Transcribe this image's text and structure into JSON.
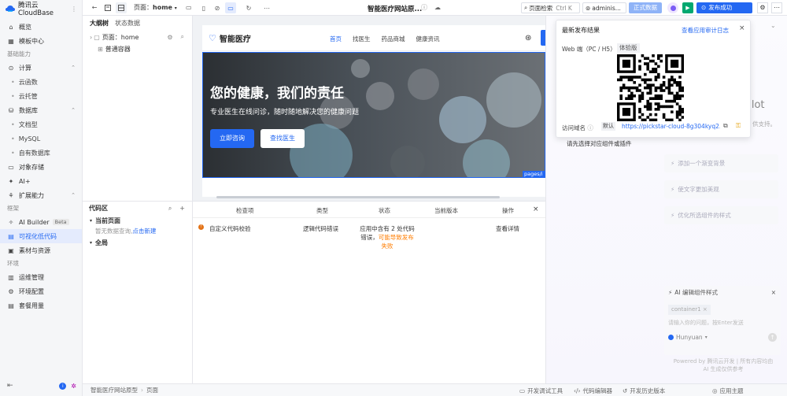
{
  "app": {
    "logo_text": "腾讯云CloudBase",
    "more": "⋮"
  },
  "sidebar": {
    "items": [
      {
        "type": "item",
        "icon": "home-icon",
        "label": "概览"
      },
      {
        "type": "item",
        "icon": "template-icon",
        "label": "模板中心"
      },
      {
        "type": "group",
        "label": "基础能力"
      },
      {
        "type": "item",
        "icon": "compute-icon",
        "label": "计算",
        "caret": true
      },
      {
        "type": "sub",
        "label": "云函数"
      },
      {
        "type": "sub",
        "label": "云托管"
      },
      {
        "type": "item",
        "icon": "database-icon",
        "label": "数据库",
        "caret": true
      },
      {
        "type": "sub",
        "label": "文档型"
      },
      {
        "type": "sub",
        "label": "MySQL"
      },
      {
        "type": "sub",
        "label": "自有数据库"
      },
      {
        "type": "item",
        "icon": "storage-icon",
        "label": "对象存储"
      },
      {
        "type": "item",
        "icon": "ai-icon",
        "label": "AI+"
      },
      {
        "type": "item",
        "icon": "extension-icon",
        "label": "扩展能力",
        "caret": true
      },
      {
        "type": "group",
        "label": "框架"
      },
      {
        "type": "item",
        "icon": "ai-builder-icon",
        "label": "AI Builder",
        "badge": "Beta"
      },
      {
        "type": "item",
        "icon": "visual-dev-icon",
        "label": "可视化低代码",
        "active": true
      },
      {
        "type": "item",
        "icon": "assets-icon",
        "label": "素材与资源"
      },
      {
        "type": "group",
        "label": "环境"
      },
      {
        "type": "item",
        "icon": "ops-icon",
        "label": "运维管理"
      },
      {
        "type": "item",
        "icon": "env-config-icon",
        "label": "环境配置"
      },
      {
        "type": "item",
        "icon": "billing-icon",
        "label": "套餐用量"
      }
    ]
  },
  "topbar": {
    "page_label": "页面：",
    "page_value": "home",
    "title": "智能医疗网站原...",
    "search_label": "页面检索",
    "search_shortcut": "Ctrl K",
    "user": "adminis...",
    "env_button": "正式数据",
    "publish_button": "发布成功"
  },
  "tree": {
    "tabs": [
      "大纲树",
      "状态数据"
    ],
    "page_node_label": "页面：home",
    "container_node": "普通容器"
  },
  "code": {
    "title": "代码区",
    "current_page": "当前页面",
    "empty_text": "暂无数据查询,",
    "create_link": "点击新建",
    "global": "全局"
  },
  "preview": {
    "logo": "智能医疗",
    "nav": [
      "首页",
      "找医生",
      "药品商城",
      "健康资讯"
    ],
    "hero_title": "您的健康，我们的责任",
    "hero_subtitle": "专业医生在线问诊，随时随地解决您的健康问题",
    "primary_button": "立即咨询",
    "secondary_button": "查找医生",
    "path_tag": "pages/i"
  },
  "checks": {
    "headers": [
      "检查项",
      "类型",
      "状态",
      "当前版本",
      "操作"
    ],
    "row": {
      "item": "自定义代码校验",
      "type": "逻辑代码错误",
      "status_1": "应用中含有 2 处代码",
      "status_2": "错误，",
      "status_warn_1": "可能导致发布",
      "status_warn_2": "失败",
      "action": "查看详情"
    },
    "close": "×"
  },
  "popup": {
    "title": "最新发布结果",
    "audit_link": "查看应用审计日志",
    "web_label": "Web 端（PC / H5）",
    "tag": "体验版",
    "domain_label": "访问域名",
    "default_tag": "默认",
    "url": "https://pickstar-cloud-8g304kyq2...",
    "hint": "请先选择对应组件或插件",
    "close": "×"
  },
  "copilot": {
    "title_fragment": "pilot",
    "desc_fragment": "供支持。",
    "suggestions": [
      "添加一个渐变背景",
      "使文字更加美观",
      "优化所选组件的样式"
    ],
    "edit_title": "AI 编辑组件样式",
    "chip": "container1",
    "input_placeholder": "请输入你的问题，按Enter发送",
    "model": "Hunyuan",
    "powered_1": "Powered by 腾讯云开发 | 所有内容均由",
    "powered_2": "AI 生成仅供参考"
  },
  "status_bar": {
    "breadcrumb": [
      "智能医疗网站原型",
      "页面"
    ],
    "tools": [
      "开发调试工具",
      "代码编辑器",
      "开发历史版本"
    ],
    "theme": "应用主题"
  },
  "colors": {
    "accent": "#2468f2",
    "success": "#00a870",
    "warning": "#ff7d00",
    "error": "#e37318"
  }
}
